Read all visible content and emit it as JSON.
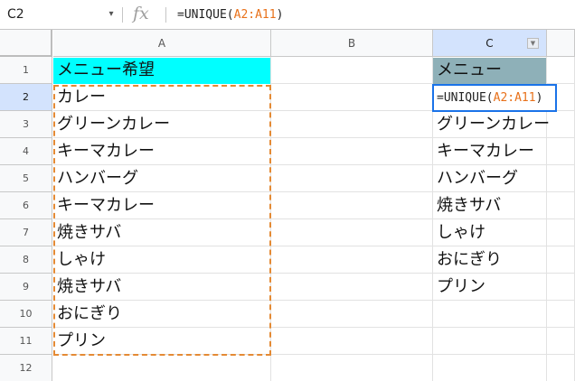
{
  "formula_bar": {
    "cell_ref": "C2",
    "name_box_arrow": "▾",
    "fx_label": "fx",
    "formula_prefix": "=UNIQUE(",
    "formula_range": "A2:A11",
    "formula_suffix": ")"
  },
  "columns": [
    "A",
    "B",
    "C"
  ],
  "column_filter_icon": "▼",
  "rows": [
    "1",
    "2",
    "3",
    "4",
    "5",
    "6",
    "7",
    "8",
    "9",
    "10",
    "11",
    "12"
  ],
  "column_a": {
    "header": "メニュー希望",
    "values": [
      "カレー",
      "グリーンカレー",
      "キーマカレー",
      "ハンバーグ",
      "キーマカレー",
      "焼きサバ",
      "しゃけ",
      "焼きサバ",
      "おにぎり",
      "プリン"
    ]
  },
  "column_c": {
    "header": "メニュー",
    "editing_prefix": "=UNIQUE(",
    "editing_range": "A2:A11",
    "editing_suffix": ")",
    "values": [
      "グリーンカレー",
      "キーマカレー",
      "ハンバーグ",
      "焼きサバ",
      "しゃけ",
      "おにぎり",
      "プリン"
    ]
  },
  "colors": {
    "header_a_fill": "#00ffff",
    "header_c_fill": "#8eb0b8",
    "copy_border": "#e48a34",
    "selection": "#1a73e8",
    "range_text": "#e8711a"
  }
}
